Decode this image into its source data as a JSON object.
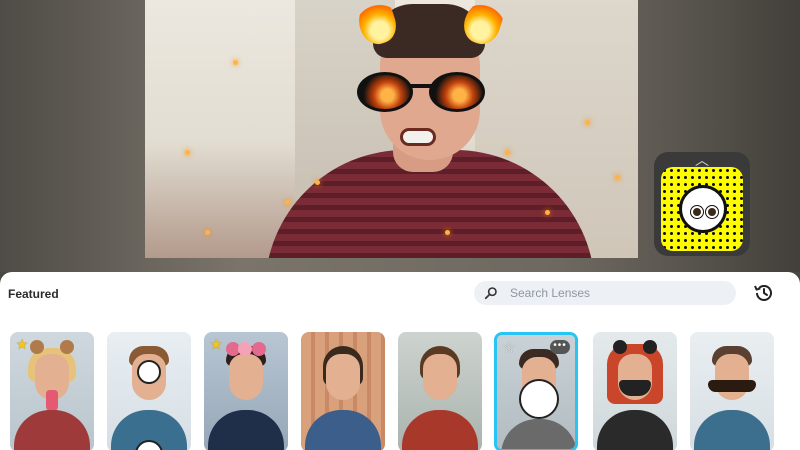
{
  "panel": {
    "featured_label": "Featured",
    "search": {
      "placeholder": "Search Lenses",
      "value": ""
    }
  },
  "icons": {
    "search": "search-icon",
    "history": "history-icon",
    "favorite": "star-icon",
    "more": "more-icon",
    "expand": "chevron-up-icon"
  },
  "colors": {
    "accent_selected": "#27c4f5",
    "snapcode_yellow": "#fffc00",
    "favorite_star": "#f5c518",
    "panel_bg": "#ffffff",
    "search_bg": "#edf1f5"
  },
  "lenses": [
    {
      "id": 1,
      "favorited": true
    },
    {
      "id": 2,
      "favorited": false
    },
    {
      "id": 3,
      "favorited": true
    },
    {
      "id": 4,
      "favorited": false
    },
    {
      "id": 5,
      "favorited": false
    },
    {
      "id": 6,
      "favorited": false,
      "selected": true
    },
    {
      "id": 7,
      "favorited": false
    },
    {
      "id": 8,
      "favorited": false
    }
  ]
}
